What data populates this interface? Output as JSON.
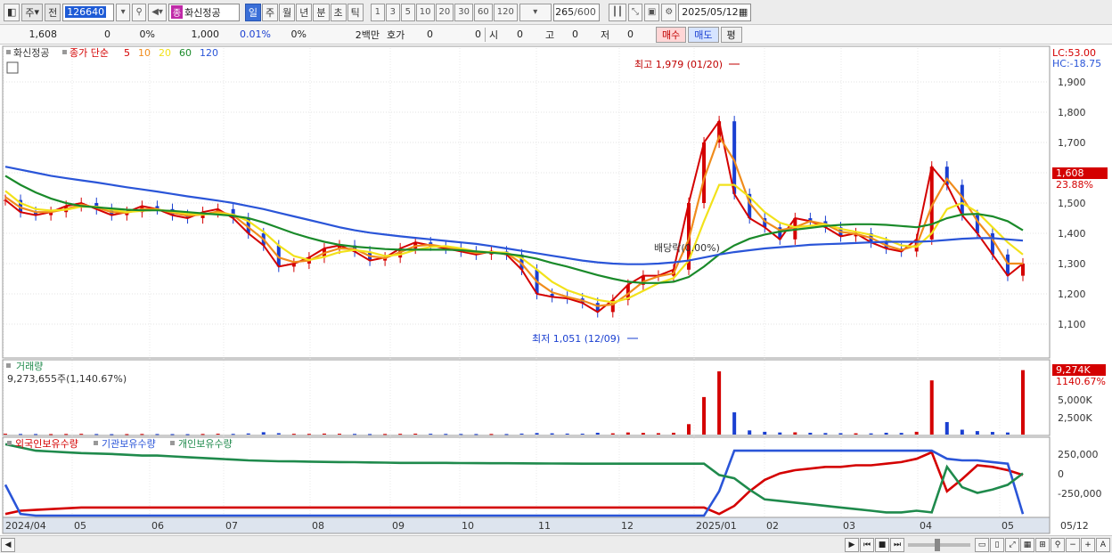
{
  "toolbar": {
    "period_label": "주",
    "prev_label": "전",
    "code": "126640",
    "stock_tag": "종",
    "stock_name": "화신정공",
    "timeframes": [
      "일",
      "주",
      "월",
      "년",
      "분",
      "초",
      "틱"
    ],
    "active_timeframe": "일",
    "intervals": [
      "1",
      "3",
      "5",
      "10",
      "20",
      "30",
      "60",
      "120"
    ],
    "count": "265",
    "count_total": "/600",
    "date": "2025/05/12"
  },
  "quote": {
    "price": "1,608",
    "change": "0",
    "change_pct": "0%",
    "volume": "1,000",
    "turnover_pct": "0.01%",
    "ratio": "0%",
    "unit": "2백만",
    "hoga_label": "호가",
    "hoga_1": "0",
    "hoga_2": "0",
    "open_label": "시",
    "open_val": "0",
    "high_label": "고",
    "high_val": "0",
    "low_label": "저",
    "low_val": "0",
    "buy_label": "매수",
    "sell_label": "매도",
    "eval_label": "평"
  },
  "price_panel": {
    "legend_name": "화신정공",
    "legend_ma_label": "종가 단순",
    "ma_periods": [
      "5",
      "10",
      "20",
      "60",
      "120"
    ],
    "ma_colors": [
      "#d40000",
      "#f08c1c",
      "#f2e21b",
      "#1a8a2a",
      "#2a55d8"
    ],
    "lc_label": "LC:53.00",
    "hc_label": "HC:-18.75",
    "high_annotation": "최고 1,979 (01/20)",
    "low_annotation": "최저 1,051 (12/09)",
    "dividend_annotation": "배당락(0.00%)",
    "current_price_tag": "1,608",
    "current_change_tag": "23.88%"
  },
  "volume_panel": {
    "title": "거래량",
    "summary": "9,273,655주(1,140.67%)",
    "current_tag": "9,274K",
    "current_pct": "1140.67%",
    "axis_labels": [
      "5,000K",
      "2,500K"
    ]
  },
  "holdings_panel": {
    "legend": [
      "외국인보유수량",
      "기관보유수량",
      "개인보유수량"
    ],
    "colors": [
      "#d40000",
      "#2a55d8",
      "#1f8a4c"
    ],
    "axis_labels": [
      "250,000",
      "0",
      "-250,000"
    ]
  },
  "x_axis": {
    "labels": [
      "2024/04",
      "05",
      "06",
      "07",
      "08",
      "09",
      "10",
      "11",
      "12",
      "2025/01",
      "02",
      "03",
      "04",
      "05",
      "05/12"
    ]
  },
  "chart_data": {
    "type": "line",
    "price_axis": {
      "ylim": [
        1000,
        2000
      ],
      "ticks": [
        "1,900",
        "1,800",
        "1,700",
        "1,600",
        "1,500",
        "1,400",
        "1,300",
        "1,200",
        "1,100"
      ]
    },
    "series": [
      {
        "name": "5",
        "values": [
          1510,
          1470,
          1460,
          1470,
          1490,
          1500,
          1480,
          1460,
          1470,
          1490,
          1480,
          1460,
          1450,
          1470,
          1480,
          1450,
          1400,
          1360,
          1290,
          1300,
          1320,
          1350,
          1360,
          1340,
          1310,
          1320,
          1350,
          1370,
          1360,
          1350,
          1340,
          1330,
          1340,
          1330,
          1280,
          1200,
          1190,
          1185,
          1170,
          1140,
          1180,
          1230,
          1260,
          1260,
          1280,
          1500,
          1700,
          1770,
          1530,
          1450,
          1420,
          1380,
          1450,
          1440,
          1420,
          1390,
          1400,
          1370,
          1350,
          1340,
          1380,
          1620,
          1560,
          1460,
          1400,
          1330,
          1260,
          1300
        ]
      },
      {
        "name": "10",
        "values": [
          1520,
          1485,
          1470,
          1470,
          1480,
          1495,
          1485,
          1470,
          1468,
          1480,
          1480,
          1468,
          1458,
          1462,
          1472,
          1460,
          1420,
          1380,
          1320,
          1305,
          1310,
          1335,
          1350,
          1348,
          1325,
          1318,
          1338,
          1358,
          1362,
          1355,
          1345,
          1335,
          1338,
          1335,
          1300,
          1240,
          1205,
          1190,
          1178,
          1160,
          1165,
          1200,
          1240,
          1258,
          1268,
          1380,
          1580,
          1720,
          1640,
          1500,
          1440,
          1410,
          1420,
          1440,
          1430,
          1405,
          1398,
          1385,
          1360,
          1345,
          1360,
          1490,
          1580,
          1520,
          1440,
          1380,
          1300,
          1300
        ]
      },
      {
        "name": "20",
        "values": [
          1540,
          1500,
          1480,
          1475,
          1478,
          1488,
          1488,
          1478,
          1470,
          1474,
          1478,
          1472,
          1464,
          1462,
          1466,
          1462,
          1440,
          1405,
          1360,
          1325,
          1312,
          1322,
          1338,
          1345,
          1338,
          1325,
          1330,
          1345,
          1355,
          1358,
          1350,
          1340,
          1338,
          1336,
          1318,
          1280,
          1240,
          1212,
          1195,
          1180,
          1172,
          1185,
          1210,
          1235,
          1252,
          1310,
          1440,
          1560,
          1560,
          1520,
          1470,
          1435,
          1420,
          1425,
          1430,
          1415,
          1405,
          1395,
          1380,
          1360,
          1355,
          1400,
          1480,
          1500,
          1470,
          1420,
          1370,
          1330
        ]
      },
      {
        "name": "60",
        "values": [
          1590,
          1560,
          1535,
          1515,
          1500,
          1490,
          1486,
          1482,
          1478,
          1476,
          1476,
          1474,
          1470,
          1466,
          1462,
          1458,
          1450,
          1436,
          1418,
          1400,
          1385,
          1372,
          1362,
          1356,
          1352,
          1348,
          1346,
          1346,
          1346,
          1346,
          1344,
          1340,
          1336,
          1332,
          1326,
          1316,
          1302,
          1290,
          1276,
          1262,
          1250,
          1240,
          1236,
          1236,
          1240,
          1256,
          1290,
          1330,
          1360,
          1382,
          1396,
          1406,
          1412,
          1418,
          1424,
          1428,
          1430,
          1430,
          1428,
          1424,
          1420,
          1430,
          1450,
          1462,
          1464,
          1456,
          1440,
          1410
        ]
      },
      {
        "name": "120",
        "values": [
          1620,
          1610,
          1600,
          1590,
          1582,
          1575,
          1568,
          1560,
          1552,
          1545,
          1538,
          1530,
          1522,
          1515,
          1508,
          1500,
          1490,
          1480,
          1468,
          1456,
          1444,
          1432,
          1420,
          1410,
          1402,
          1396,
          1390,
          1385,
          1380,
          1375,
          1370,
          1365,
          1358,
          1350,
          1342,
          1334,
          1326,
          1318,
          1310,
          1304,
          1300,
          1298,
          1298,
          1300,
          1304,
          1310,
          1320,
          1330,
          1338,
          1344,
          1350,
          1354,
          1358,
          1362,
          1364,
          1366,
          1368,
          1370,
          1372,
          1372,
          1372,
          1374,
          1378,
          1382,
          1384,
          1384,
          1380,
          1376
        ]
      }
    ],
    "volume": {
      "ylim": [
        0,
        10000
      ],
      "values": [
        120,
        90,
        80,
        70,
        90,
        110,
        80,
        60,
        70,
        90,
        80,
        70,
        60,
        90,
        120,
        100,
        160,
        340,
        200,
        110,
        100,
        140,
        120,
        100,
        80,
        90,
        110,
        130,
        120,
        100,
        90,
        80,
        90,
        80,
        140,
        220,
        180,
        140,
        130,
        260,
        180,
        300,
        240,
        200,
        260,
        1500,
        5400,
        9100,
        3200,
        600,
        400,
        300,
        320,
        260,
        220,
        200,
        180,
        170,
        260,
        240,
        400,
        7800,
        1800,
        700,
        500,
        380,
        300,
        9274
      ]
    },
    "holdings": {
      "ylim": [
        -500000,
        400000
      ],
      "series": [
        {
          "name": "외국인보유수량",
          "values": [
            -480000,
            -440000,
            -430000,
            -420000,
            -410000,
            -400000,
            -400000,
            -400000,
            -400000,
            -400000,
            -400000,
            -400000,
            -400000,
            -400000,
            -400000,
            -400000,
            -400000,
            -400000,
            -400000,
            -400000,
            -400000,
            -400000,
            -400000,
            -400000,
            -400000,
            -400000,
            -400000,
            -400000,
            -400000,
            -400000,
            -400000,
            -400000,
            -400000,
            -400000,
            -400000,
            -400000,
            -400000,
            -400000,
            -400000,
            -400000,
            -400000,
            -400000,
            -400000,
            -400000,
            -400000,
            -400000,
            -400000,
            -480000,
            -380000,
            -200000,
            -60000,
            20000,
            60000,
            80000,
            100000,
            100000,
            120000,
            120000,
            140000,
            160000,
            200000,
            280000,
            -200000,
            -50000,
            120000,
            100000,
            60000,
            0
          ]
        },
        {
          "name": "기관보유수량",
          "values": [
            -120000,
            -480000,
            -500000,
            -500000,
            -500000,
            -500000,
            -500000,
            -500000,
            -500000,
            -500000,
            -500000,
            -500000,
            -500000,
            -500000,
            -500000,
            -500000,
            -500000,
            -500000,
            -500000,
            -500000,
            -500000,
            -500000,
            -500000,
            -500000,
            -500000,
            -500000,
            -500000,
            -500000,
            -500000,
            -500000,
            -500000,
            -500000,
            -500000,
            -500000,
            -500000,
            -500000,
            -500000,
            -500000,
            -500000,
            -500000,
            -500000,
            -500000,
            -500000,
            -500000,
            -500000,
            -500000,
            -500000,
            -200000,
            300000,
            300000,
            300000,
            300000,
            300000,
            300000,
            300000,
            300000,
            300000,
            300000,
            300000,
            300000,
            300000,
            300000,
            200000,
            180000,
            180000,
            160000,
            140000,
            -480000
          ]
        },
        {
          "name": "개인보유수량",
          "values": [
            380000,
            340000,
            300000,
            290000,
            280000,
            270000,
            265000,
            260000,
            250000,
            240000,
            240000,
            230000,
            220000,
            210000,
            200000,
            190000,
            180000,
            175000,
            170000,
            168000,
            165000,
            162000,
            160000,
            158000,
            155000,
            153000,
            150000,
            150000,
            150000,
            150000,
            148000,
            146000,
            145000,
            145000,
            144000,
            143000,
            142000,
            141000,
            140000,
            140000,
            140000,
            140000,
            140000,
            140000,
            140000,
            140000,
            140000,
            0,
            -40000,
            -180000,
            -300000,
            -320000,
            -340000,
            -360000,
            -380000,
            -400000,
            -420000,
            -440000,
            -460000,
            -460000,
            -440000,
            -460000,
            100000,
            -150000,
            -220000,
            -180000,
            -120000,
            20000
          ]
        }
      ]
    }
  }
}
